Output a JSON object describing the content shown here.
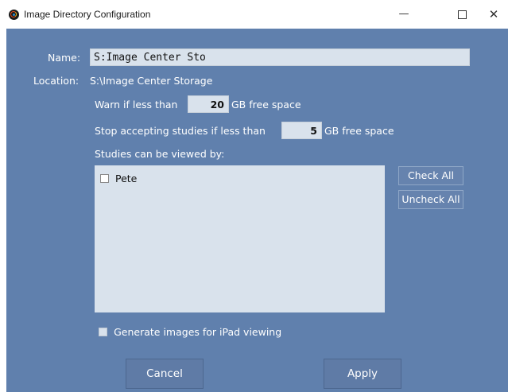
{
  "window": {
    "title": "Image Directory Configuration",
    "icon": "app-logo-icon",
    "controls": {
      "minimize": "—",
      "maximize": "",
      "close": "✕"
    }
  },
  "form": {
    "name_label": "Name:",
    "name_value": "S:Image Center Sto",
    "location_label": "Location:",
    "location_value": "S:\\Image Center Storage",
    "warn_prefix": "Warn if less than",
    "warn_value": "20",
    "warn_suffix": "GB free space",
    "stop_prefix": "Stop accepting studies if less than",
    "stop_value": "5",
    "stop_suffix": "GB free space",
    "studies_label": "Studies can be viewed by:"
  },
  "users": [
    {
      "label": "Pete",
      "checked": false
    }
  ],
  "buttons": {
    "check_all": "Check All",
    "uncheck_all": "Uncheck All",
    "cancel": "Cancel",
    "apply": "Apply"
  },
  "options": {
    "ipad_label": "Generate images for iPad viewing",
    "ipad_checked": false
  },
  "colors": {
    "background": "#6080ad",
    "field": "#d9e2ec",
    "text": "#ffffff"
  }
}
